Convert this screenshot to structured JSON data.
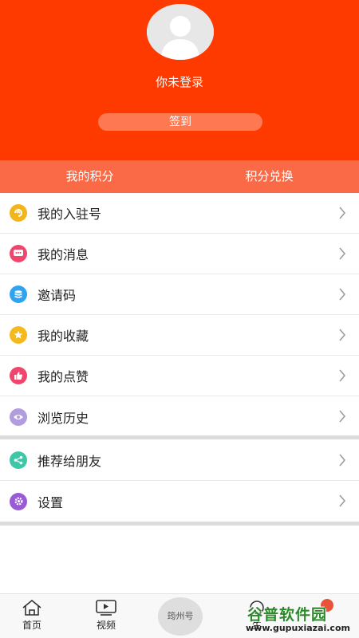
{
  "header": {
    "login_status": "你未登录",
    "signin_label": "签到",
    "background_color": "#fe3a00"
  },
  "points_bar": {
    "my_points": "我的积分",
    "points_exchange": "积分兑换"
  },
  "menu": {
    "group1": [
      {
        "label": "我的入驻号",
        "icon": "checkin-icon",
        "color": "#f2b61c"
      },
      {
        "label": "我的消息",
        "icon": "message-icon",
        "color": "#f0456c"
      },
      {
        "label": "邀请码",
        "icon": "invite-code-icon",
        "color": "#2ea3f2"
      },
      {
        "label": "我的收藏",
        "icon": "star-icon",
        "color": "#f5b91c"
      },
      {
        "label": "我的点赞",
        "icon": "thumbs-up-icon",
        "color": "#f0456c"
      },
      {
        "label": "浏览历史",
        "icon": "eye-icon",
        "color": "#b19ce0"
      }
    ],
    "group2": [
      {
        "label": "推荐给朋友",
        "icon": "share-icon",
        "color": "#3ec7a6"
      },
      {
        "label": "设置",
        "icon": "gear-icon",
        "color": "#9a59d6"
      }
    ]
  },
  "tabbar": {
    "home": "首页",
    "video": "视频",
    "center": "筠州号",
    "life": "生"
  },
  "watermark": {
    "main": "谷普软件园",
    "url": "www.gupuxiazai.com"
  }
}
